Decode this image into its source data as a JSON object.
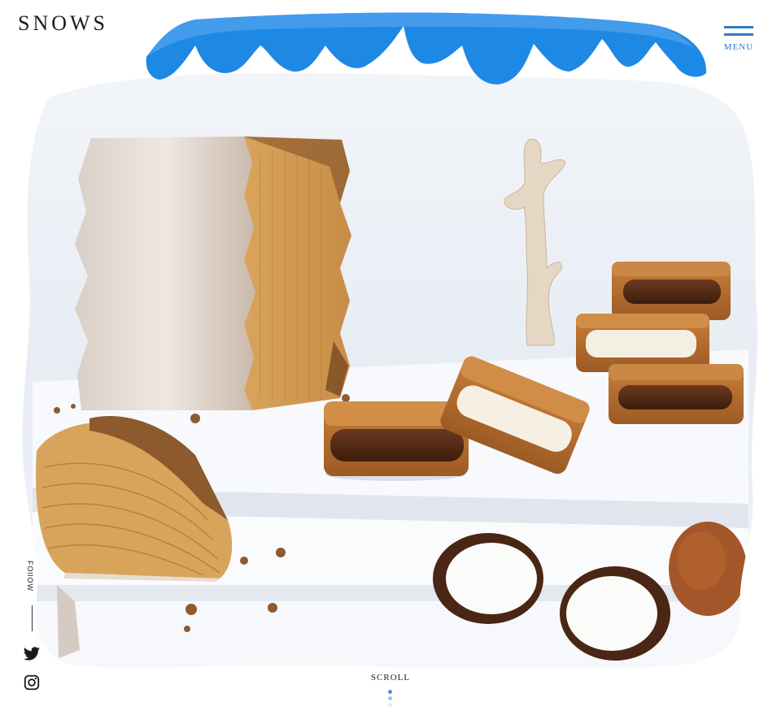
{
  "brand": {
    "logo_text": "SNOWS"
  },
  "header": {
    "menu_label": "MENU",
    "menu_icon": "hamburger-icon"
  },
  "sidebar": {
    "follow_label": "FOllOW",
    "social": [
      {
        "name": "twitter",
        "icon": "twitter-icon"
      },
      {
        "name": "instagram",
        "icon": "instagram-icon"
      }
    ]
  },
  "footer": {
    "scroll_label": "SCROLL"
  },
  "colors": {
    "accent": "#2f7cc4",
    "sky_blue": "#1e88e5",
    "background": "#ffffff",
    "photo_backdrop": "#eef2f7"
  }
}
